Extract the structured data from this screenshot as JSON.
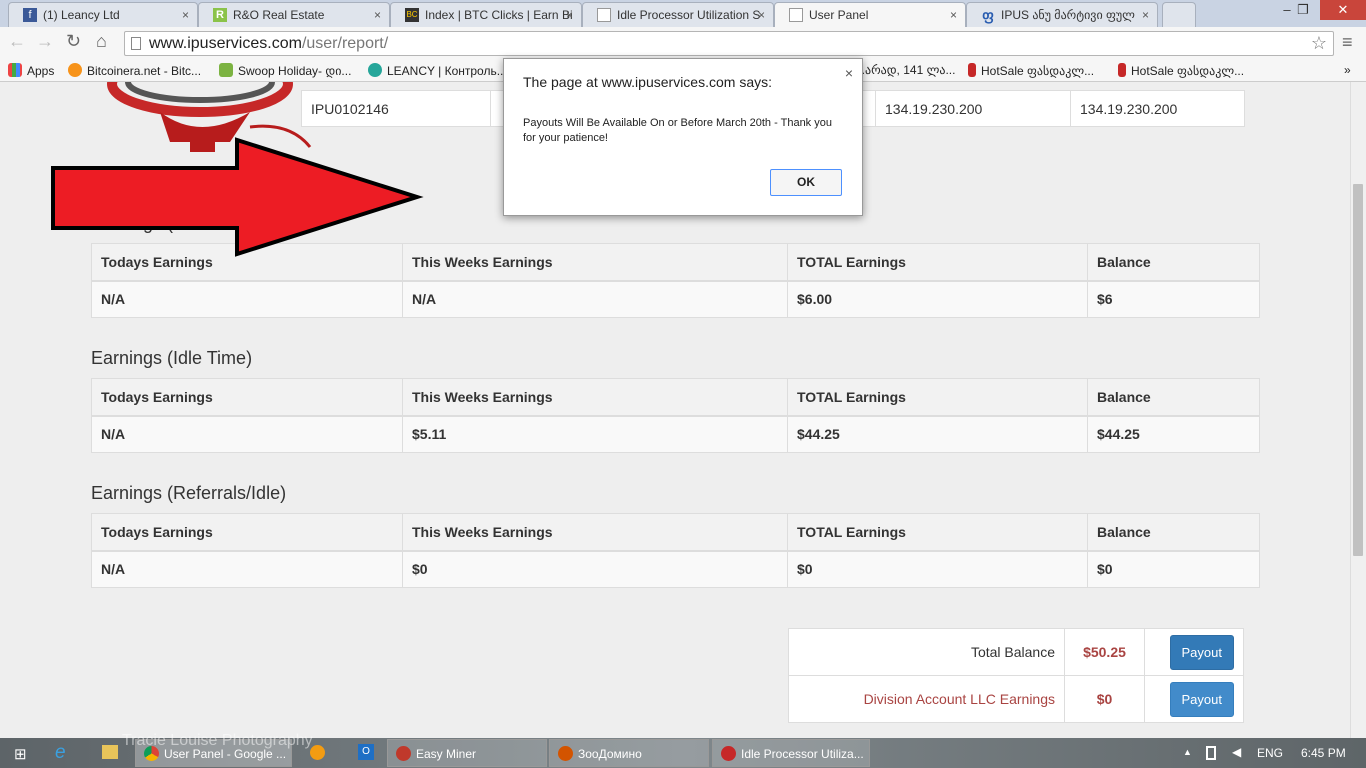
{
  "browser": {
    "tabs": [
      {
        "title": "(1) Leancy Ltd",
        "icon": "facebook-icon"
      },
      {
        "title": "R&O Real Estate",
        "icon": "r-logo-icon"
      },
      {
        "title": "Index | BTC Clicks | Earn Bi",
        "icon": "btc-icon"
      },
      {
        "title": "Idle Processor Utilization S",
        "icon": "page-icon"
      },
      {
        "title": "User Panel",
        "icon": "page-icon",
        "active": true
      },
      {
        "title": "IPUS ანუ მარტივი ფულ",
        "icon": "georgian-icon"
      }
    ],
    "url_host": "www.ipuservices.com",
    "url_path": "/user/report/",
    "bookmarks": [
      "Apps",
      "Bitcoinera.net - Bitc...",
      "Swoop Holiday- დი...",
      "LEANCY | Контроль...",
      "...არად, 141 ლა...",
      "HotSale ფასდაკლ...",
      "HotSale ფასდაკლ..."
    ],
    "more": "»"
  },
  "page": {
    "top_row": {
      "id": "IPU0102146",
      "ip1": "134.19.230.200",
      "ip2": "134.19.230.200"
    },
    "headers": [
      "Todays Earnings",
      "This Weeks Earnings",
      "TOTAL Earnings",
      "Balance"
    ],
    "sections": [
      {
        "title": "Earnings (Referrals)",
        "values": [
          "N/A",
          "N/A",
          "$6.00",
          "$6"
        ]
      },
      {
        "title": "Earnings (Idle Time)",
        "values": [
          "N/A",
          "$5.11",
          "$44.25",
          "$44.25"
        ]
      },
      {
        "title": "Earnings (Referrals/Idle)",
        "values": [
          "N/A",
          "$0",
          "$0",
          "$0"
        ]
      }
    ],
    "summary": [
      {
        "label": "Total Balance",
        "value": "$50.25",
        "button": "Payout"
      },
      {
        "label": "Division Account LLC Earnings",
        "value": "$0",
        "button": "Payout"
      }
    ]
  },
  "dialog": {
    "title": "The page at www.ipuservices.com says:",
    "message": "Payouts Will Be Available On or Before March 20th - Thank you for your patience!",
    "ok": "OK",
    "close": "×"
  },
  "taskbar": {
    "items": [
      "User Panel - Google ...",
      "Easy Miner",
      "ЗооДомино",
      "Idle Processor Utiliza..."
    ],
    "watermark": "Tracie Louise Photography",
    "lang": "ENG",
    "time": "6:45 PM"
  }
}
